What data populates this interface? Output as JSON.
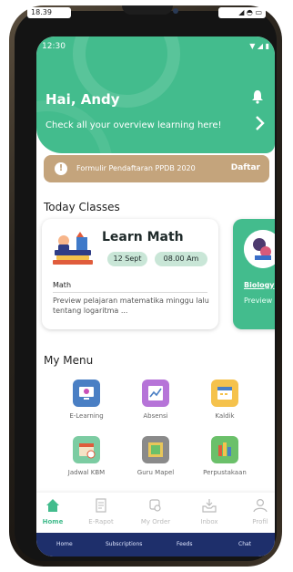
{
  "outer_status": {
    "time": "18.39",
    "right_icons": "◢ ◓ ▭"
  },
  "inner_status": {
    "time": "12:30",
    "icons": "▼ ◢ ▮"
  },
  "header": {
    "greeting": "Hai, Andy",
    "subtitle": "Check all your overview learning here!"
  },
  "banner": {
    "text": "Formulir Pendaftaran PPDB 2020",
    "action": "Daftar"
  },
  "today": {
    "title": "Today Classes",
    "cards": [
      {
        "title": "Learn Math",
        "date": "12 Sept",
        "time": "08.00 Am",
        "subject": "Math",
        "description": "Preview pelajaran matematika minggu lalu tentang logaritma ..."
      },
      {
        "subject": "Biology",
        "description": "Preview p tentang f"
      }
    ]
  },
  "menu": {
    "title": "My Menu",
    "items": [
      {
        "label": "E-Learning",
        "color": "#4a7fc4"
      },
      {
        "label": "Absensi",
        "color": "#b674d8"
      },
      {
        "label": "Kaldik",
        "color": "#f5c24c"
      },
      {
        "label": "Jadwal KBM",
        "color": "#7ccca2"
      },
      {
        "label": "Guru Mapel",
        "color": "#8a8a8a"
      },
      {
        "label": "Perpustakaan",
        "color": "#6bc06a"
      }
    ]
  },
  "nav": {
    "items": [
      {
        "label": "Home",
        "active": true
      },
      {
        "label": "E-Rapot"
      },
      {
        "label": "My Order"
      },
      {
        "label": "Inbox"
      },
      {
        "label": "Profil"
      }
    ]
  },
  "sys_bar": {
    "items": [
      "Home",
      "Subscriptions",
      "Feeds",
      "Chat"
    ]
  },
  "colors": {
    "primary": "#43bc8d",
    "banner": "#c4a47c",
    "chip": "#c9e6d7",
    "sys_bar": "#1e2f6b"
  }
}
